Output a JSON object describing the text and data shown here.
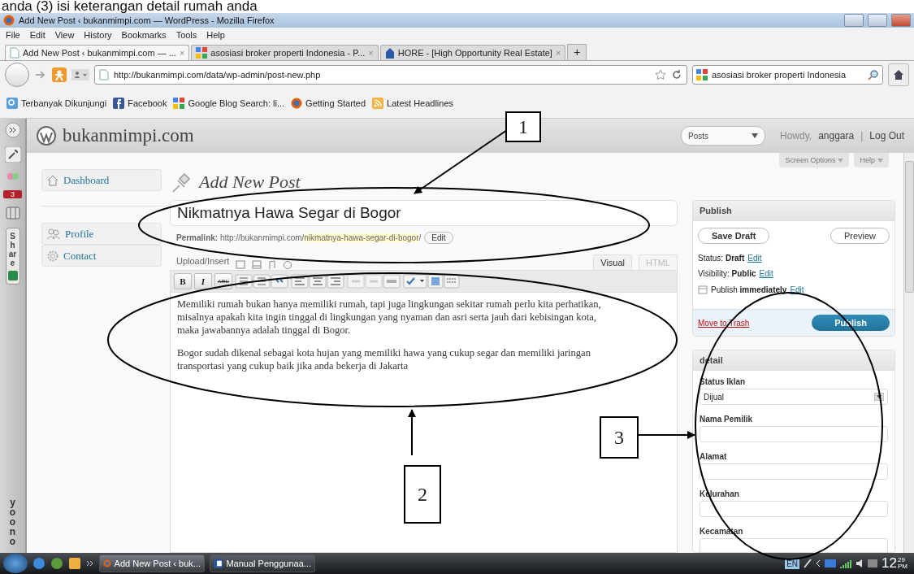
{
  "caption": "anda (3) isi keterangan detail rumah anda",
  "window": {
    "title": "Add New Post ‹ bukanmimpi.com — WordPress - Mozilla Firefox"
  },
  "menu": [
    "File",
    "Edit",
    "View",
    "History",
    "Bookmarks",
    "Tools",
    "Help"
  ],
  "tabs": [
    {
      "label": "Add New Post ‹ bukanmimpi.com — ...",
      "selected": true,
      "kind": "page",
      "close": "×"
    },
    {
      "label": "asosiasi broker properti Indonesia - P...",
      "selected": false,
      "kind": "google",
      "close": "×"
    },
    {
      "label": "HORE - [High Opportunity Real Estate]",
      "selected": false,
      "kind": "hore",
      "close": "×"
    }
  ],
  "new_tab": "+",
  "address": {
    "value": "http://bukanmimpi.com/data/wp-admin/post-new.php"
  },
  "search": {
    "value": "asosiasi broker properti Indonesia"
  },
  "bookmarks": [
    {
      "label": "Terbanyak Dikunjungi",
      "kind": "search"
    },
    {
      "label": "Facebook",
      "kind": "facebook"
    },
    {
      "label": "Google Blog Search: li...",
      "kind": "google"
    },
    {
      "label": "Getting Started",
      "kind": "firefox"
    },
    {
      "label": "Latest Headlines",
      "kind": "rss"
    }
  ],
  "side_toolbar": {
    "badge": "3",
    "share": "Share",
    "brand": "yoono"
  },
  "wp": {
    "site": "bukanmimpi.com",
    "posts_menu": "Posts",
    "howdy": "Howdy,",
    "user": "anggara",
    "separator": "|",
    "logout": "Log Out",
    "screen_options": "Screen Options",
    "help": "Help",
    "menu": [
      {
        "label": "Dashboard",
        "kind": "dashboard",
        "selected": false
      },
      {
        "label": "Profile",
        "kind": "profile",
        "selected": false
      },
      {
        "label": "Contact",
        "kind": "contact",
        "selected": false
      }
    ],
    "heading": "Add New Post",
    "title": {
      "value": "Nikmatnya Hawa Segar di Bogor"
    },
    "permalink": {
      "label": "Permalink:",
      "base": "http://bukanmimpi.com/",
      "slug": "nikmatnya-hawa-segar-di-bogor",
      "end": "/",
      "edit": "Edit"
    },
    "upload": "Upload/Insert",
    "editor_tabs": [
      {
        "label": "Visual",
        "selected": true
      },
      {
        "label": "HTML",
        "selected": false
      }
    ],
    "format_buttons": [
      {
        "label": "B",
        "kind": "bold"
      },
      {
        "label": "I",
        "kind": "italic"
      },
      {
        "label": "ABC",
        "kind": "strike"
      }
    ],
    "content": [
      "Memiliki rumah bukan hanya memiliki rumah, tapi juga lingkungan sekitar rumah perlu kita perhatikan, misalnya apakah kita ingin tinggal di lingkungan yang nyaman dan asri serta jauh dari kebisingan kota, maka jawabannya adalah tinggal di Bogor.",
      "Bogor sudah dikenal sebagai kota hujan yang memiliki hawa yang cukup segar dan memiliki jaringan transportasi yang cukup baik jika anda bekerja di Jakarta"
    ],
    "publish": {
      "title": "Publish",
      "save_draft": "Save Draft",
      "preview": "Preview",
      "rows": [
        {
          "text": "Status: **Draft**",
          "edit": "Edit",
          "kind": "plain"
        },
        {
          "text": "Visibility: **Public**",
          "edit": "Edit",
          "kind": "plain"
        },
        {
          "text": "Publish **immediately**",
          "edit": "Edit",
          "kind": "calendar"
        }
      ],
      "trash": "Move to Trash",
      "publish_button": "Publish"
    },
    "detail": {
      "title": "detail",
      "fields": [
        {
          "label": "Status Iklan",
          "kind": "select",
          "value": "Dijual"
        },
        {
          "label": "Nama Pemilik",
          "kind": "text"
        },
        {
          "label": "Alamat",
          "kind": "text"
        },
        {
          "label": "Kelurahan",
          "kind": "text"
        },
        {
          "label": "Kecamatan",
          "kind": "text"
        }
      ]
    }
  },
  "taskbar": {
    "tasks": [
      {
        "label": "Add New Post ‹ buk...",
        "kind": "firefox",
        "selected": true
      },
      {
        "label": "Manual Penggunaa...",
        "kind": "word",
        "selected": false
      }
    ],
    "lang": "EN",
    "hour": "12",
    "minute": "29",
    "ampm": "PM"
  },
  "annotations": [
    {
      "label": "1"
    },
    {
      "label": "2"
    },
    {
      "label": "3"
    }
  ]
}
